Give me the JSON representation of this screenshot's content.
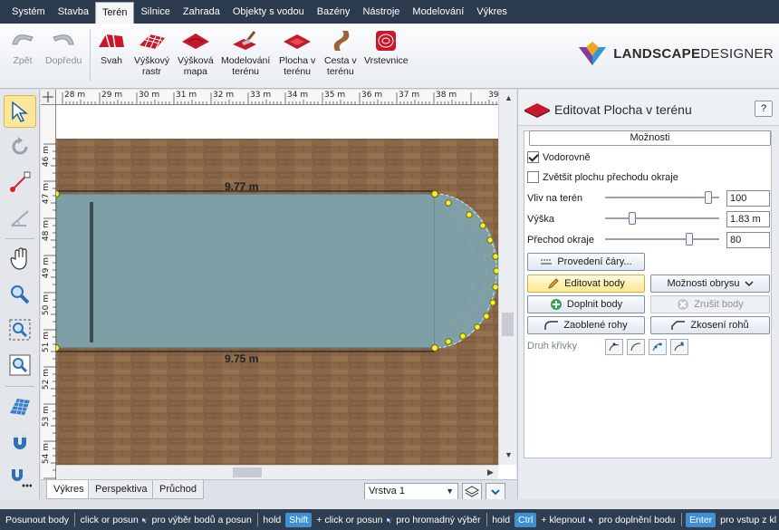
{
  "menu": [
    "Systém",
    "Stavba",
    "Terén",
    "Silnice",
    "Zahrada",
    "Objekty s vodou",
    "Bazény",
    "Nástroje",
    "Modelování",
    "Výkres"
  ],
  "menu_active": "Terén",
  "ribbon": {
    "back": "Zpět",
    "forward": "Dopředu",
    "slope": "Svah",
    "height_raster_1": "Výškový",
    "height_raster_2": "rastr",
    "height_map_1": "Výšková",
    "height_map_2": "mapa",
    "modeling_1": "Modelování",
    "modeling_2": "terénu",
    "area_1": "Plocha v",
    "area_2": "terénu",
    "path_1": "Cesta v",
    "path_2": "terénu",
    "contours": "Vrstevnice"
  },
  "logo": {
    "bold": "LANDSCAPE",
    "light": "DESIGNER"
  },
  "ruler": {
    "top": [
      "28 m",
      "29 m",
      "30 m",
      "31 m",
      "32 m",
      "33 m",
      "34 m",
      "35 m",
      "36 m",
      "37 m",
      "38 m",
      "39"
    ],
    "left": [
      "46 m",
      "47 m",
      "48 m",
      "49 m",
      "50 m",
      "51 m",
      "52 m",
      "53 m",
      "54 m"
    ]
  },
  "dims": {
    "top": "9.77 m",
    "bottom": "9.75 m"
  },
  "tabs": [
    "Výkres",
    "Perspektiva",
    "Průchod"
  ],
  "layer": "Vrstva 1",
  "panel": {
    "title": "Editovat Plocha v terénu",
    "help": "?",
    "options_tab": "Možnosti",
    "horizontal": "Vodorovně",
    "enlarge": "Zvětšit plochu přechodu okraje",
    "influence_label": "Vliv na terén",
    "influence_value": "100",
    "influence_level": 0.93,
    "height_label": "Výška",
    "height_value": "1.83 m",
    "height_level": 0.22,
    "edge_label": "Přechod okraje",
    "edge_value": "80",
    "edge_level": 0.75,
    "line_style": "Provedení čáry...",
    "edit_points": "Editovat body",
    "outline_options": "Možnosti obrysu",
    "add_points": "Doplnit body",
    "remove_points": "Zrušit body",
    "rounded_corners": "Zaoblené rohy",
    "bevel_corners": "Zkosení rohů",
    "curve_type": "Druh křivky"
  },
  "status": {
    "s1": "Posunout body",
    "s2": "click or posun",
    "s3": "pro výběr bodů a posun",
    "s4": "hold",
    "k1": "Shift",
    "s5": "+ click or posun",
    "s6": "pro hromadný výběr",
    "s7": "hold",
    "k2": "Ctrl",
    "s8": "+ klepnout",
    "s9": "pro doplnění bodu",
    "k3": "Enter",
    "s10": "pro vstup z kl"
  }
}
